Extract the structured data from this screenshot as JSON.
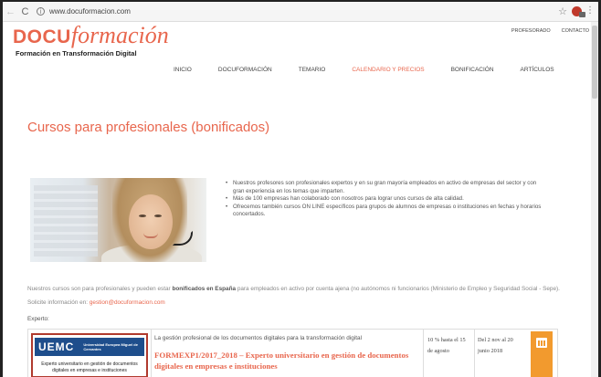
{
  "browser": {
    "back_icon": "←",
    "reload_icon": "C",
    "info_icon": "i",
    "url": "www.docuformacion.com",
    "star_icon": "☆",
    "menu_icon": "⋮"
  },
  "header": {
    "logo_part1": "DOCU",
    "logo_part2": "formación",
    "tagline": "Formación en Transformación Digital",
    "top_links": [
      "PROFESORADO",
      "CONTACTO"
    ],
    "nav": [
      "INICIO",
      "DOCUFORMACIÓN",
      "TEMARIO",
      "CALENDARIO Y PRECIOS",
      "BONIFICACIÓN",
      "ARTÍCULOS"
    ],
    "active_nav": "CALENDARIO Y PRECIOS"
  },
  "main": {
    "title": "Cursos para profesionales (bonificados)",
    "bullets": [
      "Nuestros profesores son profesionales expertos y en su gran mayoría empleados en activo de empresas del sector y con gran experiencia en los temas que imparten.",
      "Más de 100 empresas han colaborado con nosotros para lograr unos cursos de alta calidad.",
      "Ofrecemos también cursos ON LINE específicos para grupos de alumnos de empresas o instituciones en fechas y horarios concertados."
    ],
    "intro_before": "Nuestros cursos son para profesionales y pueden estar ",
    "intro_bold": "bonificados en España",
    "intro_after": " para empleados en activo por cuenta ajena (no autónomos ni funcionarios (Ministerio de Empleo y Seguridad Social - Sepe). Solicite información  en: ",
    "intro_email": "gestion@docuformacion.com",
    "experto_label": "Experto:"
  },
  "course": {
    "logo_text": "UEMC",
    "university": "Universidad Europea Miguel de Cervantes",
    "logo_subtitle": "Experto universitario en gestión de documentos digitales en empresas e instituciones",
    "description": "La gestión profesional de los documentos digitales para la transformación digital",
    "name": "FORMEXP1/2017_2018 – Experto universitario en gestión de documentos digitales en empresas e instituciones",
    "discount": "10 % hasta el 15 de agosto",
    "dates": "Del 2 nov al 20 junio 2018"
  },
  "colors": {
    "accent": "#e8664d",
    "orange_button": "#f29a2e",
    "uemc_blue": "#1e4e8c",
    "uemc_red": "#b03a2e"
  }
}
